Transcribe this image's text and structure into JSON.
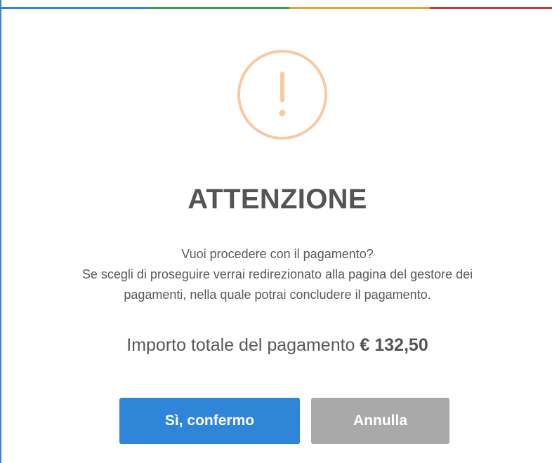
{
  "dialog": {
    "title": "ATTENZIONE",
    "icon": "exclamation-warning-icon",
    "message_lines": [
      "Vuoi procedere con il pagamento?",
      "Se scegli di proseguire verrai redirezionato alla pagina del gestore dei",
      "pagamenti, nella quale potrai concludere il pagamento."
    ],
    "amount_label": "Importo totale del pagamento",
    "amount_value": "€ 132,50",
    "confirm_label": "Sì, confermo",
    "cancel_label": "Annulla"
  },
  "colors": {
    "primary": "#2f86d9",
    "cancel": "#a9a9a9",
    "warning": "#f8c9a3",
    "title_text": "#545454",
    "body_text": "#595959",
    "bar_blue": "#2d86d8",
    "bar_green": "#2fa34f",
    "bar_yellow": "#e0a526",
    "bar_red": "#d9342b"
  }
}
